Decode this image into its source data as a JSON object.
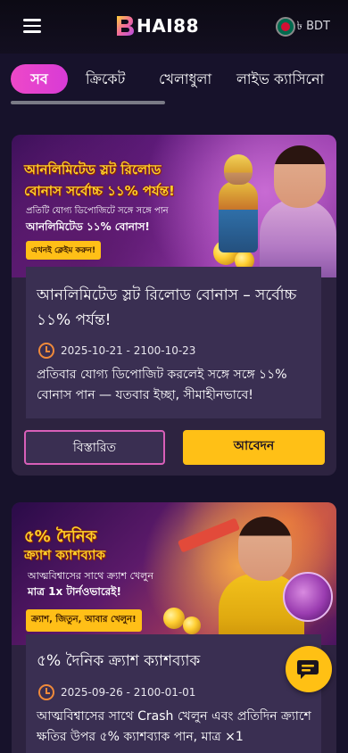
{
  "header": {
    "logo_text": "HAI88",
    "currency": "BDT"
  },
  "tabs": [
    {
      "label": "সব",
      "active": true
    },
    {
      "label": "ক্রিকেট",
      "active": false
    },
    {
      "label": "খেলাধুলা",
      "active": false
    },
    {
      "label": "লাইভ ক্যাসিনো",
      "active": false
    }
  ],
  "promos": [
    {
      "banner": {
        "title_line1": "আনলিমিটেড স্লট রিলোড",
        "title_line2": "বোনাস সর্বোচ্চ ১১% পর্যন্ত!",
        "subtitle": "প্রতিটি যোগ্য ডিপোজিটে সঙ্গে সঙ্গে পান",
        "subtitle_bold": "আনলিমিটেড ১১% বোনাস!",
        "cta": "এখনই ক্লেইম করুন!"
      },
      "title": "আনলিমিটেড স্লট রিলোড বোনাস – সর্বোচ্চ ১১% পর্যন্ত!",
      "date": "2025-10-21 - 2100-10-23",
      "description": "প্রতিবার যোগ্য ডিপোজিট করলেই সঙ্গে সঙ্গে ১১% বোনাস পান — যতবার ইচ্ছা, সীমাহীনভাবে!",
      "details_label": "বিস্তারিত",
      "apply_label": "আবেদন"
    },
    {
      "banner": {
        "title_line1": "৫% দৈনিক",
        "title_line2": "ক্র্যাশ ক্যাশব্যাক",
        "subtitle": "আত্মবিশ্বাসের সাথে ক্র্যাশ খেলুন",
        "subtitle_bold": "মাত্র 1x টার্নওভারেই!",
        "cta": "ক্র্যাশ, জিতুন, আবার খেলুন!"
      },
      "title": "৫% দৈনিক ক্র্যাশ ক্যাশব্যাক",
      "date": "2025-09-26 - 2100-01-01",
      "description": "আত্মবিশ্বাসের সাথে Crash খেলুন এবং প্রতিদিন ক্র্যাশে ক্ষতির উপর ৫% ক্যাশব্যাক পান, মাত্র ×1"
    }
  ],
  "colors": {
    "background": "#17122b",
    "card": "#2d2340",
    "active_tab": "#ee48c8",
    "apply_button": "#ffc016",
    "details_border": "#d85fb8",
    "date_icon": "#f08a3a"
  }
}
